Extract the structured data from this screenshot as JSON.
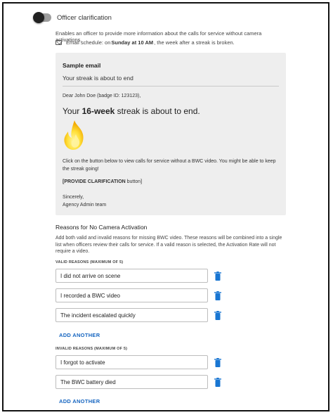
{
  "toggle": {
    "label": "Officer clarification",
    "on": true
  },
  "description": "Enables an officer to provide more information about the calls for service without camera activations.",
  "email_schedule": {
    "prefix": "Email schedule: on ",
    "day_time": "Sunday at 10 AM",
    "suffix": ", the week after a streak is broken."
  },
  "sample_email": {
    "title": "Sample email",
    "subject": "Your streak is about to end",
    "greeting": "Dear John Doe (badge ID: 123123),",
    "headline_prefix": "Your ",
    "headline_bold": "16-week",
    "headline_suffix": " streak is about to end.",
    "body": "Click on the button below to view calls for service without a BWC video. You might be able to keep the streak going!",
    "cta_bold": "[PROVIDE CLARIFICATION",
    "cta_rest": " button]",
    "sign_off": "Sincerely,",
    "signature": "Agency Admin team"
  },
  "reasons": {
    "title": "Reasons for No Camera Activation",
    "description": "Add both valid and invalid reasons for missing BWC video. These reasons will be combined into a single list when officers review their calls for service. If a valid reason is selected, the Activation Rate will not require a video.",
    "valid_label": "VALID REASONS (MAXIMUM OF 5)",
    "valid": [
      "I did not arrive on scene",
      "I recorded a BWC video",
      "The incident escalated quickly"
    ],
    "invalid_label": "INVALID REASONS (MAXIMUM OF 5)",
    "invalid": [
      "I forgot to activate",
      "The BWC battery died"
    ],
    "add_label": "ADD ANOTHER"
  },
  "colors": {
    "accent": "#1565c0",
    "card_bg": "#eeeeee",
    "flame_outer": "#f5b800",
    "flame_inner": "#ffe65c"
  },
  "icons": {
    "mail": "mail-outline-icon",
    "delete": "trash-icon",
    "flame": "flame-icon"
  }
}
